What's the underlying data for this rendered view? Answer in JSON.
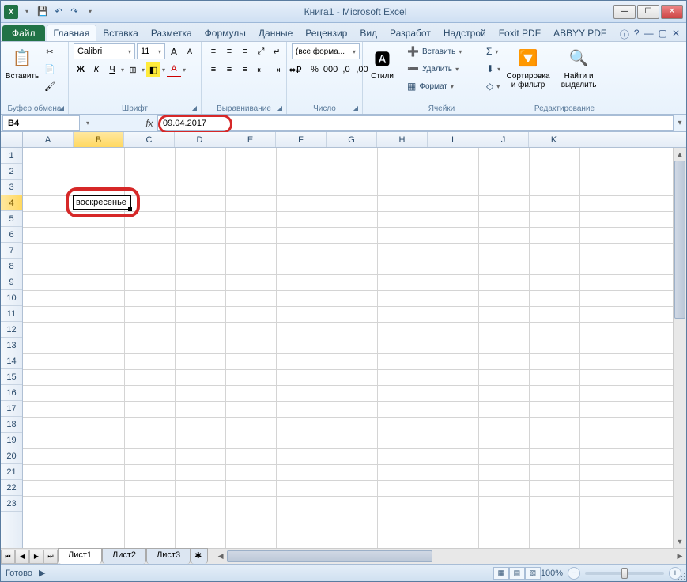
{
  "window": {
    "title": "Книга1 - Microsoft Excel"
  },
  "qat": {
    "save": "💾",
    "undo": "↶",
    "redo": "↷"
  },
  "tabs": {
    "file": "Файл",
    "items": [
      "Главная",
      "Вставка",
      "Разметка",
      "Формулы",
      "Данные",
      "Рецензир",
      "Вид",
      "Разработ",
      "Надстрой",
      "Foxit PDF",
      "ABBYY PDF"
    ],
    "active_index": 0
  },
  "ribbon": {
    "clipboard": {
      "label": "Буфер обмена",
      "paste": "Вставить",
      "cut": "✂",
      "copy": "📄",
      "brush": "🖌"
    },
    "font": {
      "label": "Шрифт",
      "name": "Calibri",
      "size": "11",
      "bold": "Ж",
      "italic": "К",
      "underline": "Ч",
      "border": "⊞",
      "fill": "◧",
      "color": "A",
      "grow": "A",
      "shrink": "A"
    },
    "align": {
      "label": "Выравнивание",
      "wrap": "↵",
      "merge": "⬌"
    },
    "number": {
      "label": "Число",
      "format": "(все форма...",
      "currency": "₽",
      "percent": "%",
      "comma": "000",
      "inc": ",0",
      "dec": ",00"
    },
    "styles": {
      "label": "Стили",
      "btn": "Стили"
    },
    "cells": {
      "label": "Ячейки",
      "insert": "Вставить",
      "delete": "Удалить",
      "format": "Формат"
    },
    "editing": {
      "label": "Редактирование",
      "sum": "Σ",
      "fill": "⬇",
      "clear": "◇",
      "sort": "Сортировка и фильтр",
      "find": "Найти и выделить"
    }
  },
  "formula_bar": {
    "name_box": "B4",
    "fx": "fx",
    "value": "09.04.2017"
  },
  "grid": {
    "columns": [
      "A",
      "B",
      "C",
      "D",
      "E",
      "F",
      "G",
      "H",
      "I",
      "J",
      "K"
    ],
    "rows": [
      1,
      2,
      3,
      4,
      5,
      6,
      7,
      8,
      9,
      10,
      11,
      12,
      13,
      14,
      15,
      16,
      17,
      18,
      19,
      20,
      21,
      22,
      23
    ],
    "active": {
      "col": "B",
      "row": 4,
      "display": "воскресенье"
    }
  },
  "sheets": {
    "nav": [
      "⏮",
      "◀",
      "▶",
      "⏭"
    ],
    "tabs": [
      "Лист1",
      "Лист2",
      "Лист3"
    ],
    "active_index": 0
  },
  "status": {
    "ready": "Готово",
    "zoom": "100%"
  }
}
